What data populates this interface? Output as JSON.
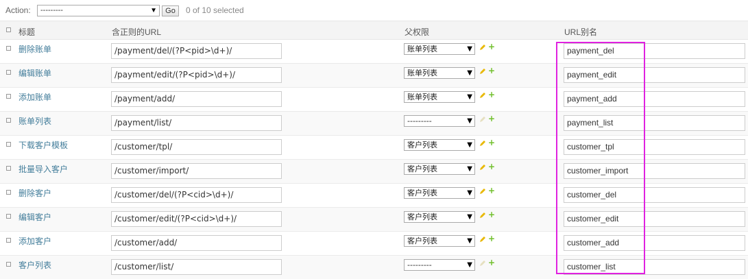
{
  "action_bar": {
    "label": "Action:",
    "select_value": "---------",
    "go_label": "Go",
    "selected_count": "0 of 10 selected"
  },
  "table": {
    "headers": {
      "title": "标题",
      "url": "含正则的URL",
      "parent": "父权限",
      "alias": "URL别名"
    },
    "rows": [
      {
        "title": "删除账单",
        "url": "/payment/del/(?P<pid>\\d+)/",
        "parent": "账单列表",
        "parent_enabled": true,
        "alias": "payment_del"
      },
      {
        "title": "编辑账单",
        "url": "/payment/edit/(?P<pid>\\d+)/",
        "parent": "账单列表",
        "parent_enabled": true,
        "alias": "payment_edit"
      },
      {
        "title": "添加账单",
        "url": "/payment/add/",
        "parent": "账单列表",
        "parent_enabled": true,
        "alias": "payment_add"
      },
      {
        "title": "账单列表",
        "url": "/payment/list/",
        "parent": "---------",
        "parent_enabled": false,
        "alias": "payment_list"
      },
      {
        "title": "下载客户模板",
        "url": "/customer/tpl/",
        "parent": "客户列表",
        "parent_enabled": true,
        "alias": "customer_tpl"
      },
      {
        "title": "批量导入客户",
        "url": "/customer/import/",
        "parent": "客户列表",
        "parent_enabled": true,
        "alias": "customer_import"
      },
      {
        "title": "删除客户",
        "url": "/customer/del/(?P<cid>\\d+)/",
        "parent": "客户列表",
        "parent_enabled": true,
        "alias": "customer_del"
      },
      {
        "title": "编辑客户",
        "url": "/customer/edit/(?P<cid>\\d+)/",
        "parent": "客户列表",
        "parent_enabled": true,
        "alias": "customer_edit"
      },
      {
        "title": "添加客户",
        "url": "/customer/add/",
        "parent": "客户列表",
        "parent_enabled": true,
        "alias": "customer_add"
      },
      {
        "title": "客户列表",
        "url": "/customer/list/",
        "parent": "---------",
        "parent_enabled": false,
        "alias": "customer_list"
      }
    ]
  },
  "colors": {
    "title_link": "#447e9b",
    "highlight_box": "#e021e0",
    "add_icon": "#70bf2b",
    "edit_icon": "#e8b800"
  },
  "icons": {
    "select_arrow": "chevron-down-icon",
    "edit": "pencil-icon",
    "add": "plus-icon"
  }
}
